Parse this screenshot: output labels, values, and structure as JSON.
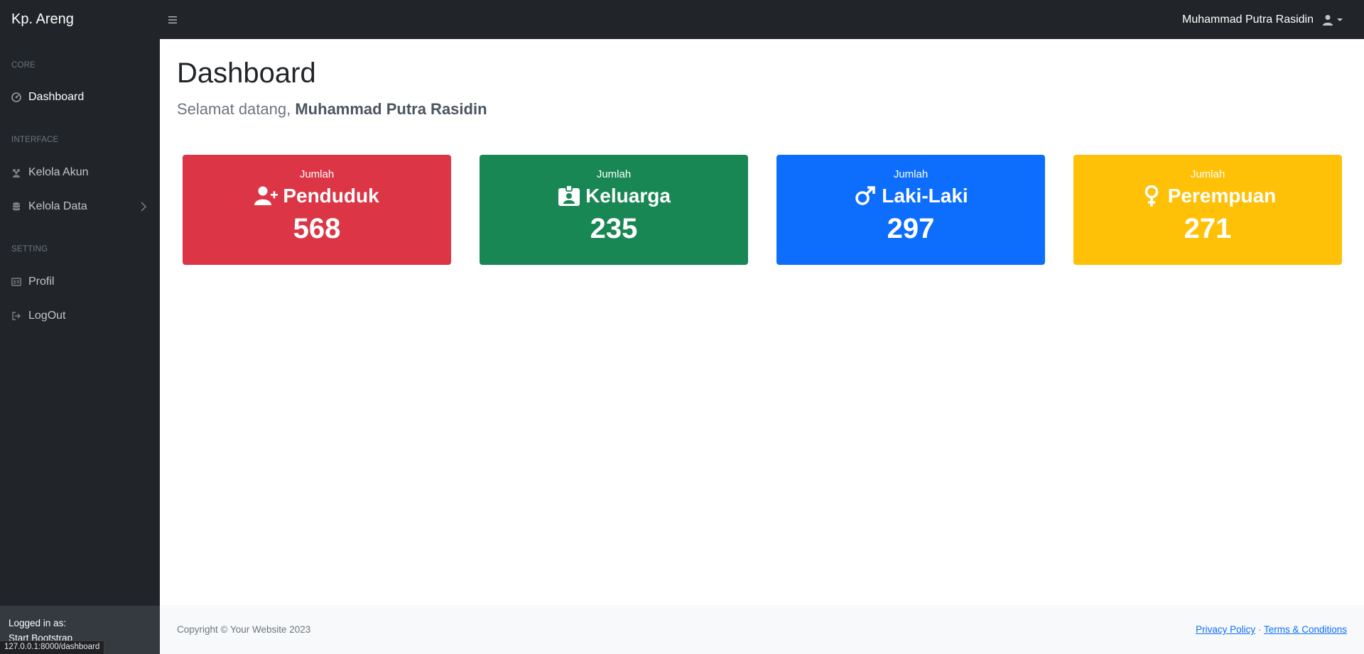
{
  "navbar": {
    "brand": "Kp. Areng",
    "user_name": "Muhammad Putra Rasidin"
  },
  "sidebar": {
    "sections": [
      {
        "heading": "Core",
        "items": [
          {
            "label": "Dashboard",
            "icon": "tachometer-icon"
          }
        ]
      },
      {
        "heading": "Interface",
        "items": [
          {
            "label": "Kelola Akun",
            "icon": "users-icon"
          },
          {
            "label": "Kelola Data",
            "icon": "database-icon"
          }
        ]
      },
      {
        "heading": "Setting",
        "items": [
          {
            "label": "Profil",
            "icon": "id-card-icon"
          },
          {
            "label": "LogOut",
            "icon": "sign-out-icon"
          }
        ]
      }
    ],
    "footer": {
      "logged_in_label": "Logged in as:",
      "user": "Start Bootstrap"
    }
  },
  "status_url": "127.0.0.1:8000/dashboard",
  "main": {
    "title": "Dashboard",
    "welcome_prefix": "Selamat datang,",
    "welcome_name": "Muhammad Putra Rasidin",
    "cards": [
      {
        "label": "Jumlah",
        "title": "Penduduk",
        "value": "568",
        "color": "#dc3545",
        "icon": "user-plus-icon"
      },
      {
        "label": "Jumlah",
        "title": "Keluarga",
        "value": "235",
        "color": "#198754",
        "icon": "id-badge-icon"
      },
      {
        "label": "Jumlah",
        "title": "Laki-Laki",
        "value": "297",
        "color": "#0d6efd",
        "icon": "mars-icon"
      },
      {
        "label": "Jumlah",
        "title": "Perempuan",
        "value": "271",
        "color": "#ffc107",
        "icon": "venus-icon"
      }
    ]
  },
  "footer": {
    "copyright": "Copyright © Your Website 2023",
    "privacy": "Privacy Policy",
    "separator": "·",
    "terms": "Terms & Conditions"
  }
}
